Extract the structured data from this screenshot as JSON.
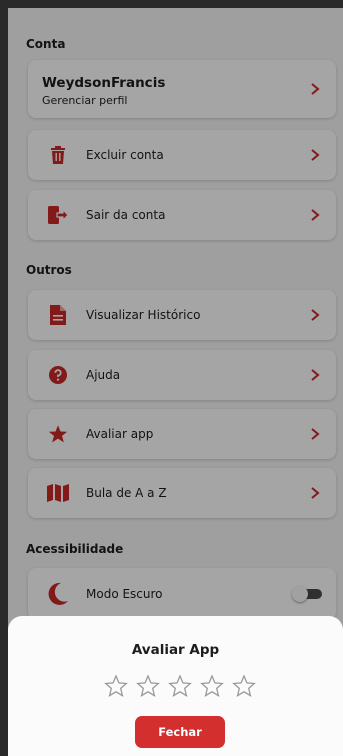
{
  "colors": {
    "accent": "#c62828",
    "button": "#d32f2f"
  },
  "sections": {
    "account": "Conta",
    "others": "Outros",
    "accessibility": "Acessibilidade"
  },
  "profile": {
    "name": "WeydsonFrancis",
    "subtitle": "Gerenciar perfil"
  },
  "menu": {
    "delete_account": "Excluir conta",
    "logout": "Sair da conta",
    "history": "Visualizar Histórico",
    "help": "Ajuda",
    "rate": "Avaliar app",
    "leaflet": "Bula de A a Z",
    "dark_mode": "Modo Escuro"
  },
  "dark_mode_on": false,
  "rating_dialog": {
    "title": "Avaliar App",
    "stars_total": 5,
    "stars_selected": 0,
    "close_label": "Fechar"
  }
}
